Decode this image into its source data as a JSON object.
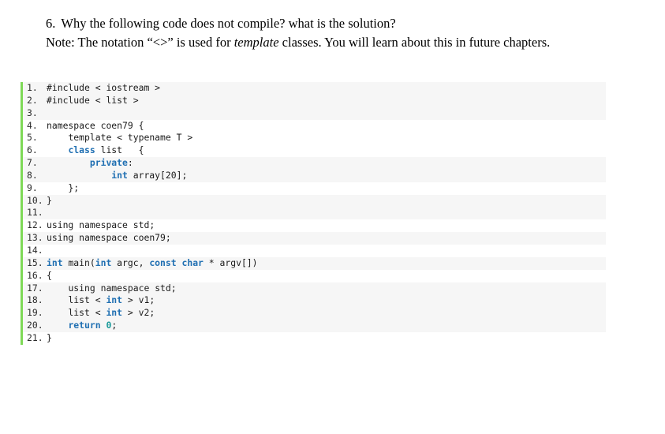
{
  "question": {
    "number": "6.",
    "line1": "Why the following code does not compile? what is the solution?",
    "note_prefix": "Note: The notation “<>” is used for ",
    "note_italic": "template",
    "note_suffix": " classes. You will learn about this in future chapters."
  },
  "colors": {
    "accent_border": "#7ed957",
    "stripe": "#f6f6f6",
    "keyword": "#1f6fb2",
    "number_literal": "#1a9a9a",
    "text": "#1a1a1a"
  },
  "code": {
    "language": "cpp",
    "lines": [
      {
        "n": "1.",
        "shaded": true,
        "text": "#include < iostream >"
      },
      {
        "n": "2.",
        "shaded": true,
        "text": "#include < list >"
      },
      {
        "n": "3.",
        "shaded": true,
        "text": ""
      },
      {
        "n": "4.",
        "shaded": false,
        "text": "namespace coen79 {"
      },
      {
        "n": "5.",
        "shaded": false,
        "text": "    template < typename T >"
      },
      {
        "n": "6.",
        "shaded": false,
        "text": "    class list   {"
      },
      {
        "n": "7.",
        "shaded": true,
        "text": "        private:"
      },
      {
        "n": "8.",
        "shaded": true,
        "text": "            int array[20];"
      },
      {
        "n": "9.",
        "shaded": false,
        "text": "    };"
      },
      {
        "n": "10.",
        "shaded": true,
        "text": "}"
      },
      {
        "n": "11.",
        "shaded": true,
        "text": ""
      },
      {
        "n": "12.",
        "shaded": false,
        "text": "using namespace std;"
      },
      {
        "n": "13.",
        "shaded": true,
        "text": "using namespace coen79;"
      },
      {
        "n": "14.",
        "shaded": false,
        "text": ""
      },
      {
        "n": "15.",
        "shaded": true,
        "text": "int main(int argc, const char * argv[])"
      },
      {
        "n": "16.",
        "shaded": false,
        "text": "{"
      },
      {
        "n": "17.",
        "shaded": true,
        "text": "    using namespace std;"
      },
      {
        "n": "18.",
        "shaded": true,
        "text": "    list < int > v1;"
      },
      {
        "n": "19.",
        "shaded": true,
        "text": "    list < int > v2;"
      },
      {
        "n": "20.",
        "shaded": true,
        "text": "    return 0;"
      },
      {
        "n": "21.",
        "shaded": false,
        "text": "}"
      }
    ],
    "keywords": [
      "class",
      "private",
      "int",
      "const",
      "char",
      "return"
    ],
    "number_literals": [
      "0"
    ]
  }
}
